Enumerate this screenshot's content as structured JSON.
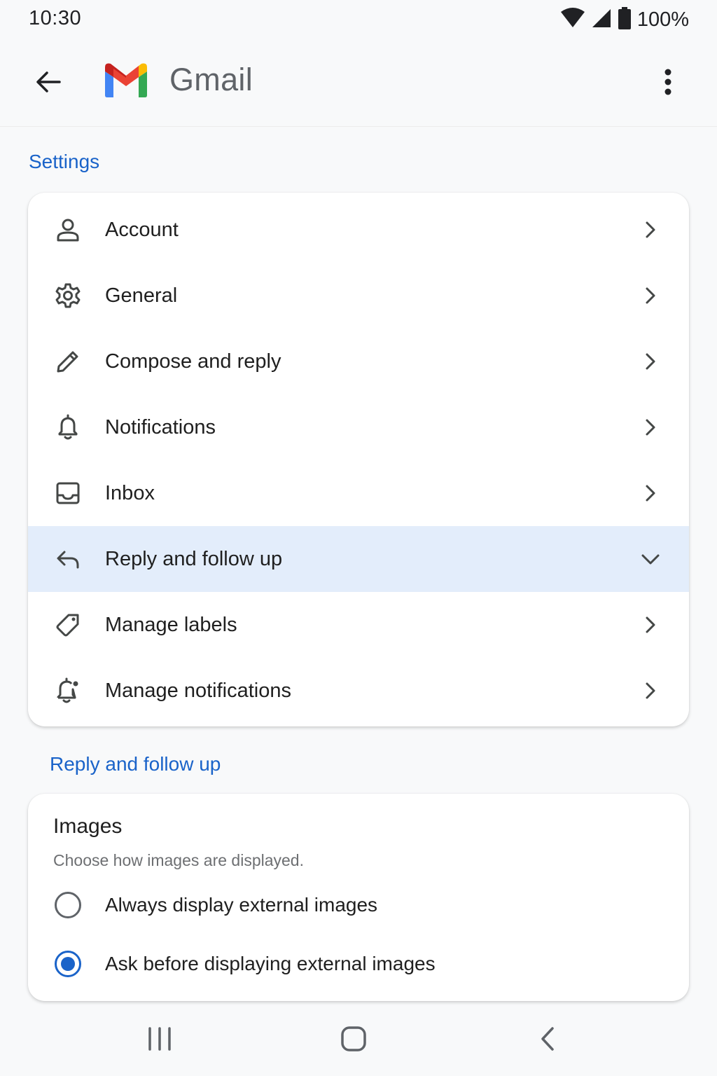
{
  "status_bar": {
    "time": "10:30",
    "battery": "100%",
    "icons": [
      "wifi-icon",
      "signal-icon",
      "battery-icon"
    ]
  },
  "app_bar": {
    "title": "Gmail",
    "back_icon": "arrow-back-icon",
    "more_icon": "more-vert-icon"
  },
  "settings": {
    "heading": "Settings",
    "items": [
      {
        "label": "Account",
        "icon": "person-icon",
        "state": "collapsed"
      },
      {
        "label": "General",
        "icon": "gear-icon",
        "state": "collapsed"
      },
      {
        "label": "Compose and reply",
        "icon": "pencil-icon",
        "state": "collapsed"
      },
      {
        "label": "Notifications",
        "icon": "bell-icon",
        "state": "collapsed"
      },
      {
        "label": "Inbox",
        "icon": "inbox-icon",
        "state": "collapsed"
      },
      {
        "label": "Reply and follow up",
        "icon": "reply-icon",
        "state": "expanded"
      },
      {
        "label": "Manage labels",
        "icon": "label-icon",
        "state": "collapsed"
      },
      {
        "label": "Manage notifications",
        "icon": "bell-settings-icon",
        "state": "collapsed"
      }
    ]
  },
  "reply_section": {
    "heading": "Reply and follow up",
    "images": {
      "title": "Images",
      "description": "Choose how images are displayed.",
      "options": [
        {
          "label": "Always display external images",
          "selected": false
        },
        {
          "label": "Ask before displaying external images",
          "selected": true
        }
      ]
    }
  },
  "nav_bar": {
    "icons": [
      "recents-icon",
      "home-icon",
      "nav-back-icon"
    ]
  },
  "colors": {
    "accent": "#1a63c9",
    "selected_row": "#e3edfb",
    "background": "#f8f9fa"
  }
}
